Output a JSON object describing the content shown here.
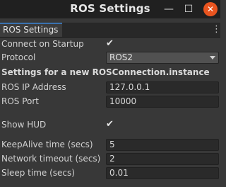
{
  "window": {
    "title": "ROS Settings",
    "minimize_glyph": "—",
    "maximize_glyph": "☐",
    "close_glyph": "✕"
  },
  "tab": {
    "label": "ROS Settings",
    "menu_glyph": "⋮"
  },
  "settings": {
    "connect_on_startup": {
      "label": "Connect on Startup",
      "checked": true,
      "check_glyph": "✔"
    },
    "protocol": {
      "label": "Protocol",
      "value": "ROS2"
    },
    "section_title": "Settings for a new ROSConnection.instance",
    "ros_ip": {
      "label": "ROS IP Address",
      "value": "127.0.0.1"
    },
    "ros_port": {
      "label": "ROS Port",
      "value": "10000"
    },
    "show_hud": {
      "label": "Show HUD",
      "checked": true,
      "check_glyph": "✔"
    },
    "keepalive": {
      "label": "KeepAlive time (secs)",
      "value": "5"
    },
    "network_timeout": {
      "label": "Network timeout (secs)",
      "value": "2"
    },
    "sleep_time": {
      "label": "Sleep time (secs)",
      "value": "0.01"
    }
  },
  "colors": {
    "background": "#383838",
    "titlebar": "#202020",
    "close_button": "#e9541f",
    "tab_accent": "#3a72b0"
  },
  "icons": [
    "minimize-icon",
    "maximize-icon",
    "close-icon",
    "kebab-menu-icon",
    "checkmark-icon",
    "dropdown-arrow-icon"
  ]
}
